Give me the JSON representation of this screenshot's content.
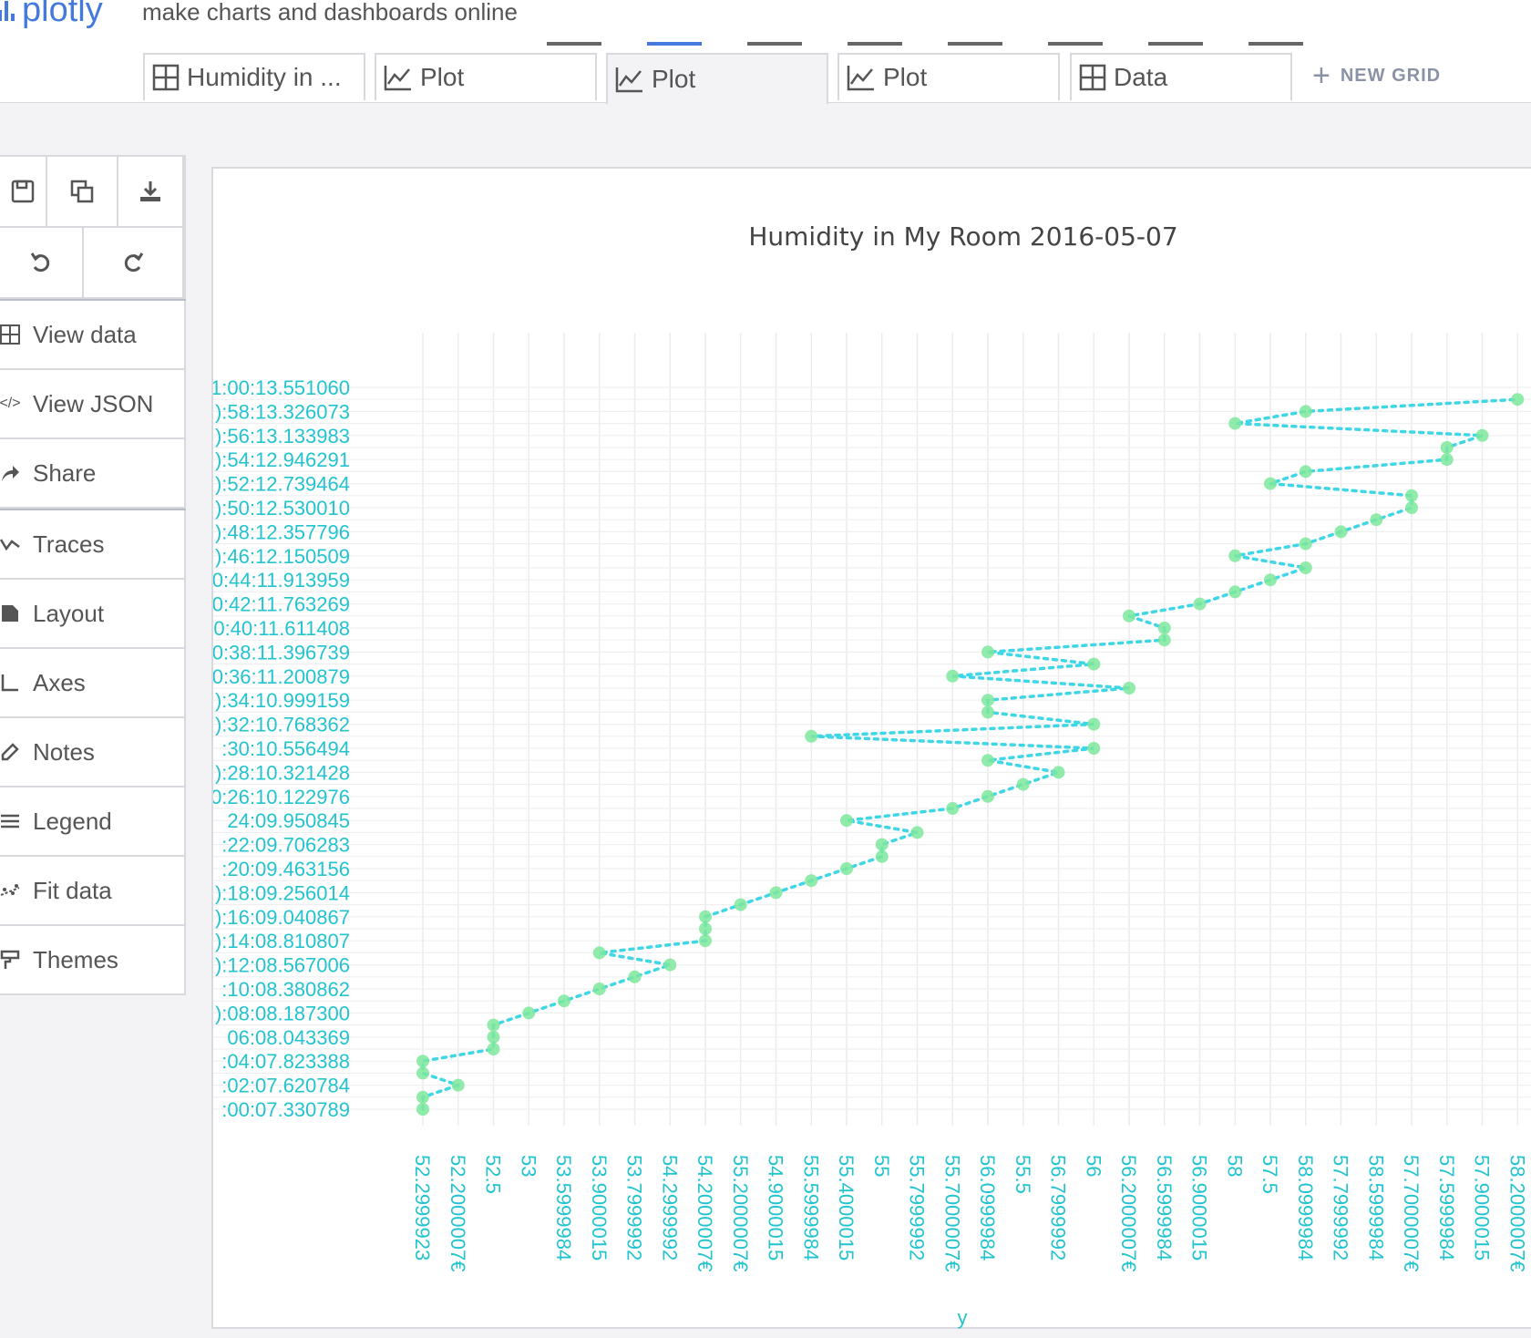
{
  "app": {
    "logo_text": "plotly",
    "tagline": "make charts and dashboards online"
  },
  "tabs": [
    {
      "label": "Humidity in ...",
      "icon": "grid-icon"
    },
    {
      "label": "Plot",
      "icon": "line-chart-icon"
    },
    {
      "label": "Plot",
      "icon": "line-chart-icon",
      "active": true
    },
    {
      "label": "Plot",
      "icon": "line-chart-icon"
    },
    {
      "label": "Data",
      "icon": "grid-icon"
    }
  ],
  "new_grid_label": "NEW GRID",
  "toolbar_icons": [
    "save-icon",
    "copy-icon",
    "download-icon",
    "undo-icon",
    "redo-icon"
  ],
  "menu": [
    {
      "label": "View data",
      "icon": "grid-icon"
    },
    {
      "label": "View JSON",
      "icon": "code-icon"
    },
    {
      "label": "Share",
      "icon": "share-icon"
    },
    {
      "label": "Traces",
      "icon": "traces-icon"
    },
    {
      "label": "Layout",
      "icon": "layout-icon"
    },
    {
      "label": "Axes",
      "icon": "axes-icon"
    },
    {
      "label": "Notes",
      "icon": "notes-icon"
    },
    {
      "label": "Legend",
      "icon": "legend-icon"
    },
    {
      "label": "Fit data",
      "icon": "fit-data-icon"
    },
    {
      "label": "Themes",
      "icon": "themes-icon"
    }
  ],
  "colors": {
    "accent": "#447adb",
    "trace_line": "#3fd6e6",
    "trace_marker": "#7ee89c",
    "tick_text": "#23c4cf"
  },
  "chart_data": {
    "type": "scatter",
    "mode": "lines+markers",
    "title": "Humidity in My Room 2016-05-07",
    "xlabel": "y",
    "x_categories": [
      "52.2999923",
      "52.2000007€",
      "52.5",
      "53",
      "53.5999984",
      "53.9000015",
      "53.7999992",
      "54.2999992",
      "54.2000007€",
      "55.2000007€",
      "54.9000015",
      "55.5999984",
      "55.4000015",
      "55",
      "55.7999992",
      "55.7000007€",
      "56.0999984",
      "55.5",
      "56.7999992",
      "56",
      "56.2000007€",
      "56.5999984",
      "56.9000015",
      "58",
      "57.5",
      "58.0999984",
      "57.7999992",
      "58.5999984",
      "57.7000007€",
      "57.5999984",
      "57.9000015",
      "58.2000007€"
    ],
    "y_tick_labels": [
      "1:00:13.551060",
      "):58:13.326073",
      "):56:13.133983",
      "):54:12.946291",
      "):52:12.739464",
      "):50:12.530010",
      "):48:12.357796",
      "):46:12.150509",
      "0:44:11.913959",
      "0:42:11.763269",
      "00:40:11.611408",
      "0:38:11.396739",
      "0:36:11.200879",
      "):34:10.999159",
      "):32:10.768362",
      ":30:10.556494",
      "):28:10.321428",
      "0:26:10.122976",
      "24:09.950845",
      ":22:09.706283",
      ":20:09.463156",
      "):18:09.256014",
      "):16:09.040867",
      "):14:08.810807",
      "):12:08.567006",
      ":10:08.380862",
      "):08:08.187300",
      "06:08.043369",
      ":04:07.823388",
      ":02:07.620784",
      ":00:07.330789"
    ],
    "points": [
      {
        "x": 0,
        "y": 0
      },
      {
        "x": 0,
        "y": 0.5
      },
      {
        "x": 1,
        "y": 1
      },
      {
        "x": 0,
        "y": 1.5
      },
      {
        "x": 0,
        "y": 2
      },
      {
        "x": 2,
        "y": 2.5
      },
      {
        "x": 2,
        "y": 3
      },
      {
        "x": 2,
        "y": 3.5
      },
      {
        "x": 3,
        "y": 4
      },
      {
        "x": 4,
        "y": 4.5
      },
      {
        "x": 5,
        "y": 5
      },
      {
        "x": 6,
        "y": 5.5
      },
      {
        "x": 7,
        "y": 6
      },
      {
        "x": 5,
        "y": 6.5
      },
      {
        "x": 8,
        "y": 7
      },
      {
        "x": 8,
        "y": 7.5
      },
      {
        "x": 8,
        "y": 8
      },
      {
        "x": 9,
        "y": 8.5
      },
      {
        "x": 10,
        "y": 9
      },
      {
        "x": 11,
        "y": 9.5
      },
      {
        "x": 12,
        "y": 10
      },
      {
        "x": 13,
        "y": 10.5
      },
      {
        "x": 13,
        "y": 11
      },
      {
        "x": 14,
        "y": 11.5
      },
      {
        "x": 12,
        "y": 12
      },
      {
        "x": 15,
        "y": 12.5
      },
      {
        "x": 16,
        "y": 13
      },
      {
        "x": 17,
        "y": 13.5
      },
      {
        "x": 18,
        "y": 14
      },
      {
        "x": 16,
        "y": 14.5
      },
      {
        "x": 19,
        "y": 15
      },
      {
        "x": 11,
        "y": 15.5
      },
      {
        "x": 19,
        "y": 16
      },
      {
        "x": 16,
        "y": 16.5
      },
      {
        "x": 16,
        "y": 17
      },
      {
        "x": 20,
        "y": 17.5
      },
      {
        "x": 15,
        "y": 18
      },
      {
        "x": 19,
        "y": 18.5
      },
      {
        "x": 16,
        "y": 19
      },
      {
        "x": 21,
        "y": 19.5
      },
      {
        "x": 21,
        "y": 20
      },
      {
        "x": 20,
        "y": 20.5
      },
      {
        "x": 22,
        "y": 21
      },
      {
        "x": 23,
        "y": 21.5
      },
      {
        "x": 24,
        "y": 22
      },
      {
        "x": 25,
        "y": 22.5
      },
      {
        "x": 23,
        "y": 23
      },
      {
        "x": 25,
        "y": 23.5
      },
      {
        "x": 26,
        "y": 24
      },
      {
        "x": 27,
        "y": 24.5
      },
      {
        "x": 28,
        "y": 25
      },
      {
        "x": 28,
        "y": 25.5
      },
      {
        "x": 24,
        "y": 26
      },
      {
        "x": 25,
        "y": 26.5
      },
      {
        "x": 29,
        "y": 27
      },
      {
        "x": 29,
        "y": 27.5
      },
      {
        "x": 30,
        "y": 28
      },
      {
        "x": 23,
        "y": 28.5
      },
      {
        "x": 25,
        "y": 29
      },
      {
        "x": 31,
        "y": 29.5
      }
    ],
    "grid": true
  }
}
